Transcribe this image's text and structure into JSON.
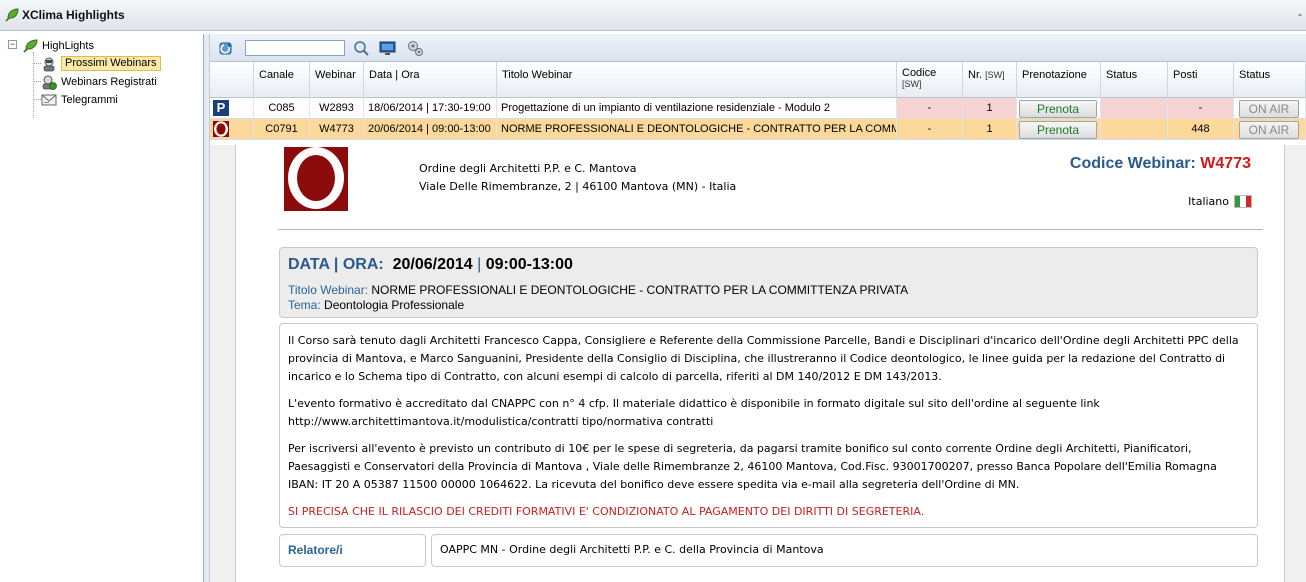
{
  "window": {
    "title": "XClima Highlights",
    "minimize_glyph": "-"
  },
  "tree": {
    "root": {
      "label": "HighLights",
      "expander": "−",
      "icon": "leaf-icon"
    },
    "items": [
      {
        "label": "Prossimi Webinars",
        "icon": "webinar-icon",
        "selected": true
      },
      {
        "label": "Webinars Registrati",
        "icon": "recorded-icon",
        "selected": false
      },
      {
        "label": "Telegrammi",
        "icon": "telegram-icon",
        "selected": false
      }
    ]
  },
  "toolbar": {
    "search": {
      "value": "",
      "placeholder": ""
    },
    "icons": [
      "refresh-icon",
      "search-icon",
      "monitor-icon",
      "settings-icon"
    ]
  },
  "grid": {
    "columns": [
      {
        "label": ""
      },
      {
        "label": "Canale"
      },
      {
        "label": "Webinar"
      },
      {
        "label": "Data | Ora"
      },
      {
        "label": "Titolo Webinar"
      },
      {
        "label": "Codice",
        "sub": "[SW]"
      },
      {
        "label": "Nr.",
        "sub": "[SW]"
      },
      {
        "label": "Prenotazione"
      },
      {
        "label": "Status"
      },
      {
        "label": "Posti"
      },
      {
        "label": "Status"
      }
    ],
    "rows": [
      {
        "badge": "P",
        "canale": "C085",
        "webinar": "W2893",
        "data_ora": "18/06/2014 | 17:30-19:00",
        "titolo": "Progettazione di un impianto di ventilazione residenziale - Modulo 2",
        "codice": "-",
        "nr": "1",
        "prenota": "Prenota",
        "status": "",
        "posti": "-",
        "onair": "ON AIR"
      },
      {
        "badge": "",
        "canale": "C0791",
        "webinar": "W4773",
        "data_ora": "20/06/2014 | 09:00-13:00",
        "titolo": "NORME PROFESSIONALI E DEONTOLOGICHE - CONTRATTO PER LA COMMITTENZA PRIVATA",
        "codice": "-",
        "nr": "1",
        "prenota": "Prenota",
        "status": "",
        "posti": "448",
        "onair": "ON AIR"
      }
    ]
  },
  "detail": {
    "org_name": "Ordine degli Architetti P.P. e C. Mantova",
    "org_address": "Viale Delle Rimembranze, 2 | 46100 Mantova (MN) - Italia",
    "codice_label": "Codice Webinar:",
    "codice_value": "W4773",
    "language": "Italiano",
    "date_label": "DATA | ORA:",
    "date_value": "20/06/2014",
    "date_sep": "|",
    "time_value": "09:00-13:00",
    "titolo_label": "Titolo Webinar:",
    "titolo_value": "NORME PROFESSIONALI E DEONTOLOGICHE - CONTRATTO PER LA COMMITTENZA PRIVATA",
    "tema_label": "Tema:",
    "tema_value": "Deontologia Professionale",
    "paragraphs": [
      "Il Corso sarà tenuto dagli Architetti Francesco Cappa, Consigliere e Referente della Commissione Parcelle, Bandi e Disciplinari d'incarico dell'Ordine degli Architetti PPC della provincia di Mantova, e Marco Sanguanini, Presidente della Consiglio di Disciplina, che illustreranno il Codice deontologico, le linee guida per la redazione del Contratto di incarico e lo Schema tipo di Contratto, con alcuni esempi di calcolo di parcella, riferiti al DM 140/2012 E DM 143/2013.",
      "L'evento formativo è accreditato dal CNAPPC con n° 4 cfp. Il materiale didattico è disponibile in formato digitale sul sito dell'ordine al seguente link http://www.architettimantova.it/modulistica/contratti tipo/normativa contratti",
      "Per iscriversi all'evento è previsto un contributo di 10€ per le spese di segreteria, da pagarsi tramite bonifico sul conto corrente Ordine degli Architetti, Pianificatori, Paesaggisti e Conservatori della Provincia di Mantova , Viale delle Rimembranze 2, 46100 Mantova, Cod.Fisc. 93001700207, presso Banca Popolare dell'Emilia Romagna IBAN: IT 20 A 05387 11500 00000 1064622. La ricevuta del bonifico deve essere spedita via e-mail alla segreteria dell'Ordine di MN."
    ],
    "notice": "SI PRECISA CHE IL RILASCIO DEI CREDITI FORMATIVI E' CONDIZIONATO AL PAGAMENTO DEI DIRITTI DI SEGRETERIA.",
    "relatore_label": "Relatore/i",
    "relatore_value": "OAPPC MN - Ordine degli Architetti P.P. e C. della Provincia di Mantova"
  },
  "colors": {
    "accent_blue": "#2a5a8c",
    "code_red": "#d21818",
    "row_selected": "#fcd99a",
    "pink_cell": "#f7d4d4",
    "prenota_green": "#1f7a25"
  }
}
